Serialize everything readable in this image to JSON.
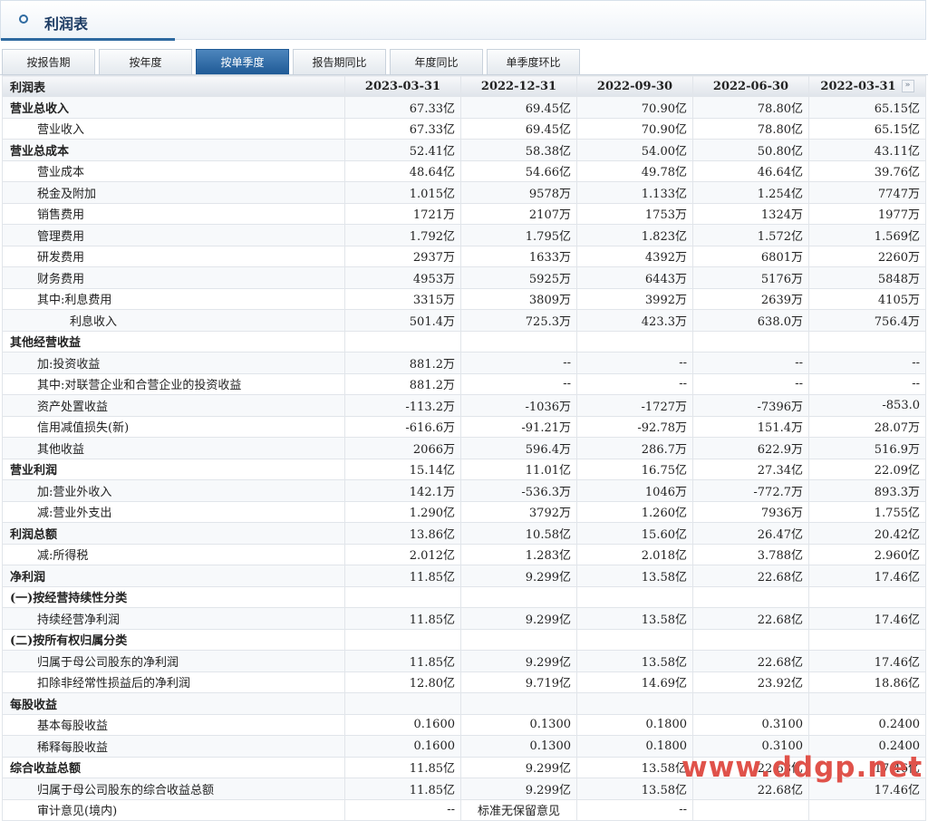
{
  "panel": {
    "title": "利润表"
  },
  "tabs": [
    {
      "label": "按报告期",
      "active": false
    },
    {
      "label": "按年度",
      "active": false
    },
    {
      "label": "按单季度",
      "active": true
    },
    {
      "label": "报告期同比",
      "active": false
    },
    {
      "label": "年度同比",
      "active": false
    },
    {
      "label": "单季度环比",
      "active": false
    }
  ],
  "table": {
    "header_label": "利润表",
    "dates": [
      "2023-03-31",
      "2022-12-31",
      "2022-09-30",
      "2022-06-30",
      "2022-03-31"
    ],
    "next_button": "»",
    "rows": [
      {
        "label": "营业总收入",
        "level": "section",
        "values": [
          "67.33亿",
          "69.45亿",
          "70.90亿",
          "78.80亿",
          "65.15亿"
        ]
      },
      {
        "label": "营业收入",
        "level": "indent1",
        "values": [
          "67.33亿",
          "69.45亿",
          "70.90亿",
          "78.80亿",
          "65.15亿"
        ]
      },
      {
        "label": "营业总成本",
        "level": "section",
        "values": [
          "52.41亿",
          "58.38亿",
          "54.00亿",
          "50.80亿",
          "43.11亿"
        ]
      },
      {
        "label": "营业成本",
        "level": "indent1",
        "values": [
          "48.64亿",
          "54.66亿",
          "49.78亿",
          "46.64亿",
          "39.76亿"
        ]
      },
      {
        "label": "税金及附加",
        "level": "indent1",
        "values": [
          "1.015亿",
          "9578万",
          "1.133亿",
          "1.254亿",
          "7747万"
        ]
      },
      {
        "label": "销售费用",
        "level": "indent1",
        "values": [
          "1721万",
          "2107万",
          "1753万",
          "1324万",
          "1977万"
        ]
      },
      {
        "label": "管理费用",
        "level": "indent1",
        "values": [
          "1.792亿",
          "1.795亿",
          "1.823亿",
          "1.572亿",
          "1.569亿"
        ]
      },
      {
        "label": "研发费用",
        "level": "indent1",
        "values": [
          "2937万",
          "1633万",
          "4392万",
          "6801万",
          "2260万"
        ]
      },
      {
        "label": "财务费用",
        "level": "indent1",
        "values": [
          "4953万",
          "5925万",
          "6443万",
          "5176万",
          "5848万"
        ]
      },
      {
        "label": "其中:利息费用",
        "level": "indent1",
        "values": [
          "3315万",
          "3809万",
          "3992万",
          "2639万",
          "4105万"
        ]
      },
      {
        "label": "利息收入",
        "level": "indent2",
        "values": [
          "501.4万",
          "725.3万",
          "423.3万",
          "638.0万",
          "756.4万"
        ]
      },
      {
        "label": "其他经营收益",
        "level": "section",
        "values": [
          "",
          "",
          "",
          "",
          ""
        ]
      },
      {
        "label": "加:投资收益",
        "level": "indent1",
        "values": [
          "881.2万",
          "--",
          "--",
          "--",
          "--"
        ]
      },
      {
        "label": "其中:对联营企业和合营企业的投资收益",
        "level": "indent1",
        "values": [
          "881.2万",
          "--",
          "--",
          "--",
          "--"
        ]
      },
      {
        "label": "资产处置收益",
        "level": "indent1",
        "values": [
          "-113.2万",
          "-1036万",
          "-1727万",
          "-7396万",
          "-853.0"
        ]
      },
      {
        "label": "信用减值损失(新)",
        "level": "indent1",
        "values": [
          "-616.6万",
          "-91.21万",
          "-92.78万",
          "151.4万",
          "28.07万"
        ]
      },
      {
        "label": "其他收益",
        "level": "indent1",
        "values": [
          "2066万",
          "596.4万",
          "286.7万",
          "622.9万",
          "516.9万"
        ]
      },
      {
        "label": "营业利润",
        "level": "section",
        "values": [
          "15.14亿",
          "11.01亿",
          "16.75亿",
          "27.34亿",
          "22.09亿"
        ]
      },
      {
        "label": "加:营业外收入",
        "level": "indent1",
        "values": [
          "142.1万",
          "-536.3万",
          "1046万",
          "-772.7万",
          "893.3万"
        ]
      },
      {
        "label": "减:营业外支出",
        "level": "indent1",
        "values": [
          "1.290亿",
          "3792万",
          "1.260亿",
          "7936万",
          "1.755亿"
        ]
      },
      {
        "label": "利润总额",
        "level": "section",
        "values": [
          "13.86亿",
          "10.58亿",
          "15.60亿",
          "26.47亿",
          "20.42亿"
        ]
      },
      {
        "label": "减:所得税",
        "level": "indent1",
        "values": [
          "2.012亿",
          "1.283亿",
          "2.018亿",
          "3.788亿",
          "2.960亿"
        ]
      },
      {
        "label": "净利润",
        "level": "section",
        "values": [
          "11.85亿",
          "9.299亿",
          "13.58亿",
          "22.68亿",
          "17.46亿"
        ]
      },
      {
        "label": "(一)按经营持续性分类",
        "level": "section",
        "values": [
          "",
          "",
          "",
          "",
          ""
        ]
      },
      {
        "label": "持续经营净利润",
        "level": "indent1",
        "values": [
          "11.85亿",
          "9.299亿",
          "13.58亿",
          "22.68亿",
          "17.46亿"
        ]
      },
      {
        "label": "(二)按所有权归属分类",
        "level": "section",
        "values": [
          "",
          "",
          "",
          "",
          ""
        ]
      },
      {
        "label": "归属于母公司股东的净利润",
        "level": "indent1",
        "values": [
          "11.85亿",
          "9.299亿",
          "13.58亿",
          "22.68亿",
          "17.46亿"
        ]
      },
      {
        "label": "扣除非经常性损益后的净利润",
        "level": "indent1",
        "values": [
          "12.80亿",
          "9.719亿",
          "14.69亿",
          "23.92亿",
          "18.86亿"
        ]
      },
      {
        "label": "每股收益",
        "level": "section",
        "values": [
          "",
          "",
          "",
          "",
          ""
        ]
      },
      {
        "label": "基本每股收益",
        "level": "indent1",
        "values": [
          "0.1600",
          "0.1300",
          "0.1800",
          "0.3100",
          "0.2400"
        ]
      },
      {
        "label": "稀释每股收益",
        "level": "indent1",
        "values": [
          "0.1600",
          "0.1300",
          "0.1800",
          "0.3100",
          "0.2400"
        ]
      },
      {
        "label": "综合收益总额",
        "level": "section",
        "values": [
          "11.85亿",
          "9.299亿",
          "13.58亿",
          "22.68亿",
          "17.46亿"
        ]
      },
      {
        "label": "归属于母公司股东的综合收益总额",
        "level": "indent1",
        "values": [
          "11.85亿",
          "9.299亿",
          "13.58亿",
          "22.68亿",
          "17.46亿"
        ]
      },
      {
        "label": "审计意见(境内)",
        "level": "indent1",
        "values": [
          "--",
          "标准无保留意见",
          "--",
          "",
          ""
        ],
        "center_cols": [
          1
        ]
      }
    ]
  },
  "watermark": {
    "text": "www.ddgp.net"
  },
  "colors": {
    "accent": "#2e6aa0",
    "watermark": "#e0524a"
  }
}
